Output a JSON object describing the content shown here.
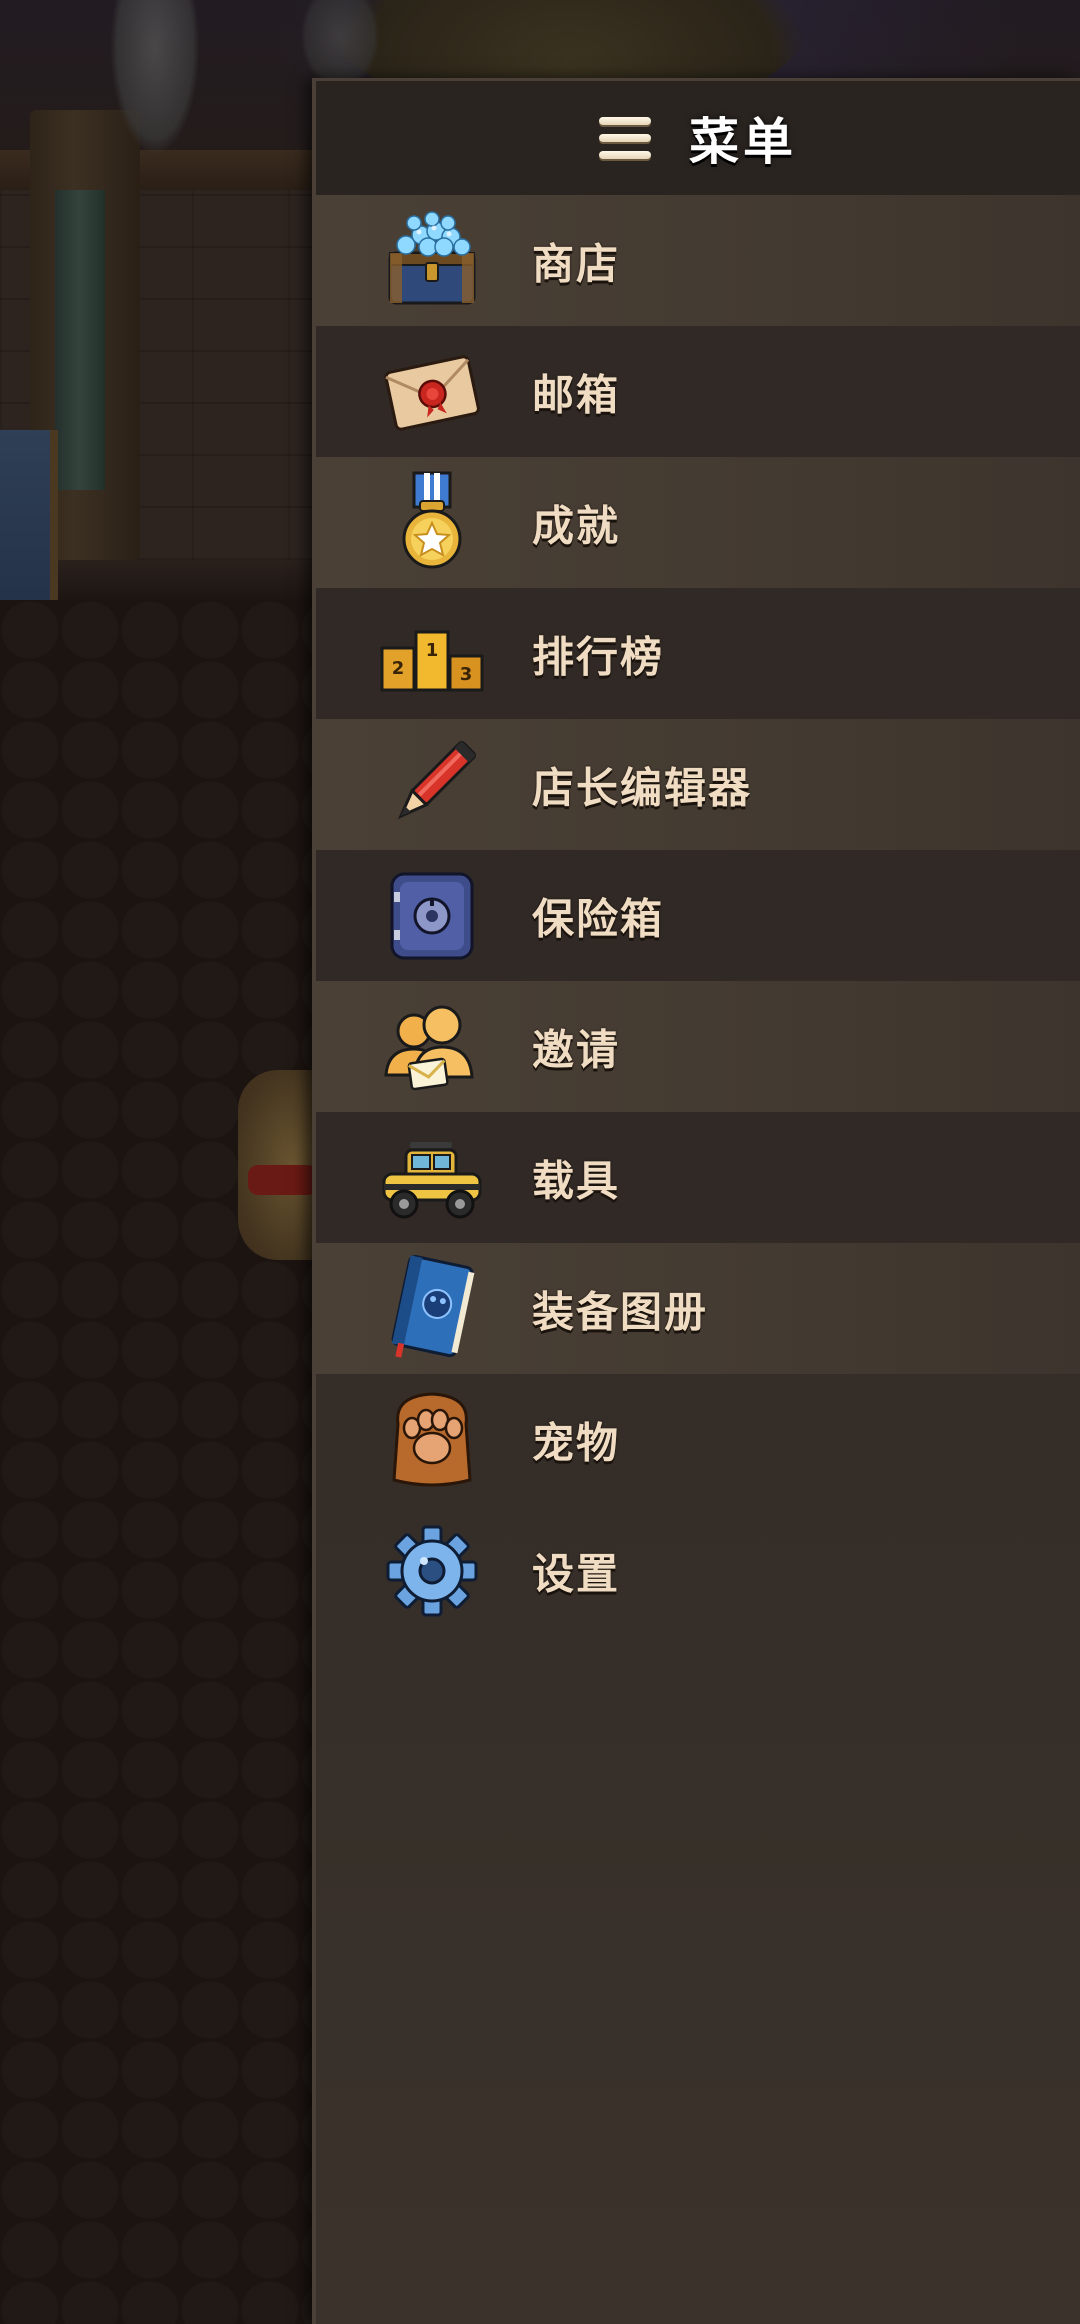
{
  "menu": {
    "title": "菜单",
    "items": [
      {
        "label": "商店",
        "icon": "gem-chest-icon"
      },
      {
        "label": "邮箱",
        "icon": "mail-envelope-icon"
      },
      {
        "label": "成就",
        "icon": "medal-icon"
      },
      {
        "label": "排行榜",
        "icon": "podium-icon"
      },
      {
        "label": "店长编辑器",
        "icon": "pencil-icon"
      },
      {
        "label": "保险箱",
        "icon": "safe-icon"
      },
      {
        "label": "邀请",
        "icon": "friends-invite-icon"
      },
      {
        "label": "载具",
        "icon": "vehicle-icon"
      },
      {
        "label": "装备图册",
        "icon": "equipment-book-icon"
      },
      {
        "label": "宠物",
        "icon": "paw-icon"
      },
      {
        "label": "设置",
        "icon": "gear-icon"
      }
    ]
  },
  "podium_numbers": [
    "2",
    "1",
    "3"
  ]
}
